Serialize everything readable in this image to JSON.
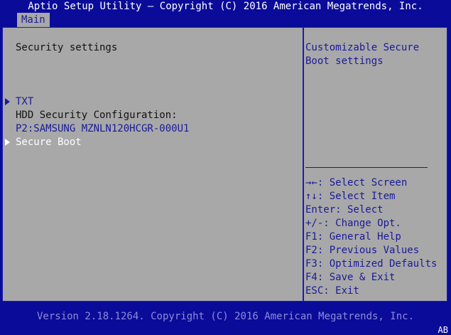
{
  "header": {
    "title": "Aptio Setup Utility – Copyright (C) 2016 American Megatrends, Inc.",
    "tabs": [
      {
        "label": "Main"
      }
    ]
  },
  "main": {
    "section_title": "Security settings",
    "items": [
      {
        "label": "TXT",
        "submenu": true,
        "selected": false
      },
      {
        "label": "HDD Security Configuration:",
        "submenu": false
      },
      {
        "label": "P2:SAMSUNG MZNLN120HCGR-000U1",
        "submenu": false
      },
      {
        "label": "Secure Boot",
        "submenu": true,
        "selected": true
      }
    ]
  },
  "help": {
    "description": [
      "Customizable Secure",
      "Boot settings"
    ],
    "keys": [
      "→←: Select Screen",
      "↑↓: Select Item",
      "Enter: Select",
      "+/-: Change Opt.",
      "F1: General Help",
      "F2: Previous Values",
      "F3: Optimized Defaults",
      "F4: Save & Exit",
      "ESC: Exit"
    ]
  },
  "footer": {
    "version": "Version 2.18.1264. Copyright (C) 2016 American Megatrends, Inc.",
    "corner_code": "AB"
  },
  "colors": {
    "background": "#0b0b9a",
    "panel": "#a8a8a8",
    "highlight_text": "#ffffff",
    "item_text": "#1a1a9a",
    "label_text": "#111111",
    "footer_text": "#8c8cd8"
  }
}
